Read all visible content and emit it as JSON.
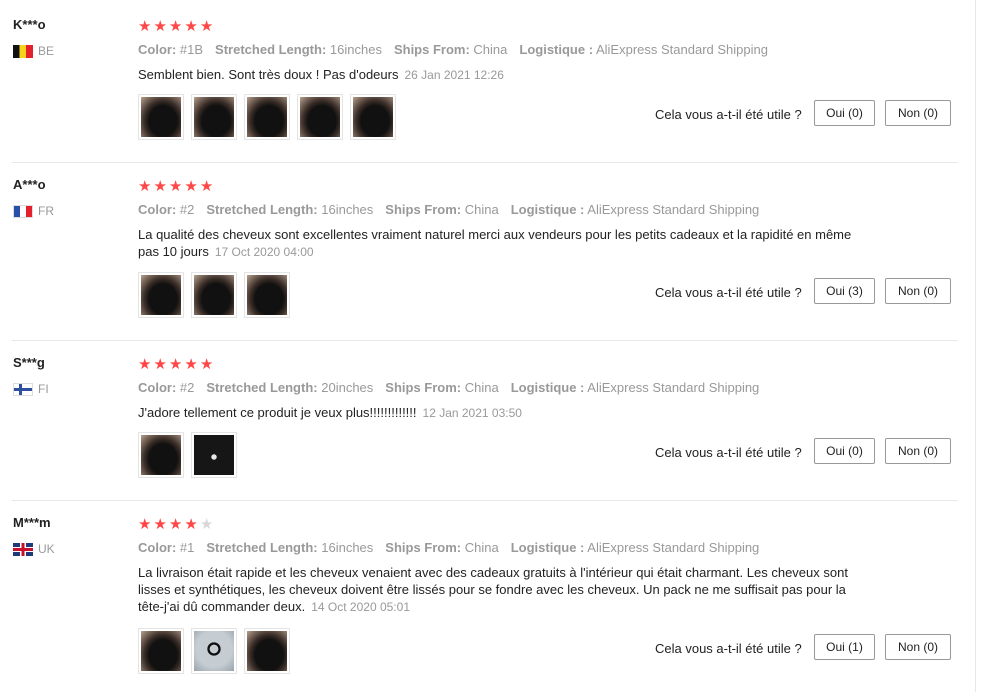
{
  "labels": {
    "color": "Color:",
    "length": "Stretched Length:",
    "ships": "Ships From:",
    "logistics": "Logistique :",
    "helpful": "Cela vous a-t-il été utile ?"
  },
  "reviews": [
    {
      "user": "K***o",
      "country": "BE",
      "rating": 5,
      "color": "#1B",
      "length": "16inches",
      "ships": "China",
      "logistics": "AliExpress Standard Shipping",
      "text": "Semblent bien. Sont très doux ! Pas d'odeurs",
      "date": "26 Jan 2021 12:26",
      "images": [
        "hair-photo",
        "hair-photo",
        "hair-photo",
        "hair-photo",
        "hair-photo"
      ],
      "yes": "Oui (0)",
      "no": "Non (0)"
    },
    {
      "user": "A***o",
      "country": "FR",
      "rating": 5,
      "color": "#2",
      "length": "16inches",
      "ships": "China",
      "logistics": "AliExpress Standard Shipping",
      "text": "La qualité des cheveux sont excellentes vraiment naturel merci aux vendeurs pour les petits cadeaux et la rapidité en même pas 10 jours",
      "date": "17 Oct 2020 04:00",
      "images": [
        "hair-photo",
        "hair-photo",
        "hair-photo"
      ],
      "yes": "Oui (3)",
      "no": "Non (0)"
    },
    {
      "user": "S***g",
      "country": "FI",
      "rating": 5,
      "color": "#2",
      "length": "20inches",
      "ships": "China",
      "logistics": "AliExpress Standard Shipping",
      "text": "J'adore tellement ce produit je veux plus!!!!!!!!!!!!!",
      "date": "12 Jan 2021 03:50",
      "images": [
        "hair-photo",
        "package-photo"
      ],
      "yes": "Oui (0)",
      "no": "Non (0)"
    },
    {
      "user": "M***m",
      "country": "UK",
      "rating": 4,
      "color": "#1",
      "length": "16inches",
      "ships": "China",
      "logistics": "AliExpress Standard Shipping",
      "text": "La livraison était rapide et les cheveux venaient avec des cadeaux gratuits à l'intérieur qui était charmant. Les cheveux sont lisses et synthétiques, les cheveux doivent être lissés pour se fondre avec les cheveux. Un pack ne me suffisait pas pour la tête-j'ai dû commander deux.",
      "date": "14 Oct 2020 05:01",
      "images": [
        "hair-photo",
        "hair-tie-photo",
        "hair-photo"
      ],
      "yes": "Oui (1)",
      "no": "Non (0)"
    }
  ],
  "colors": {
    "star_on": "#ff4747",
    "star_off": "#d8d8d8",
    "muted": "#999999"
  }
}
